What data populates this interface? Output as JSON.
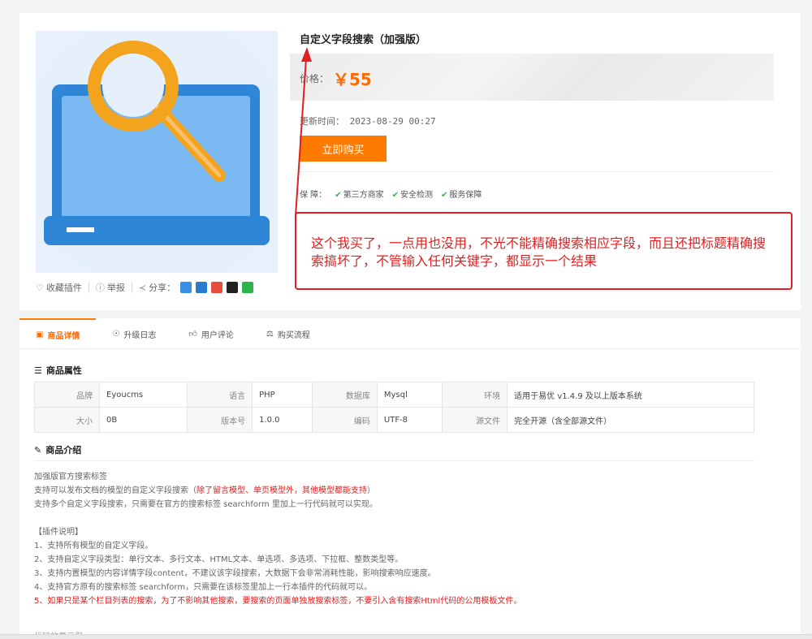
{
  "product": {
    "title": "自定义字段搜索（加强版）",
    "price_label": "价格：",
    "price": "￥55",
    "update_label": "更新时间：",
    "update_time": "2023-08-29 00:27",
    "buy_label": "立即购买",
    "guarantee_label": "保  障：",
    "guarantees": [
      "第三方商家",
      "安全检测",
      "服务保障"
    ]
  },
  "actions": {
    "favorite": "收藏插件",
    "report": "举报",
    "share": "分享："
  },
  "annotation": {
    "text": "这个我买了，一点用也没用，不光不能精确搜索相应字段，而且还把标题精确搜索搞坏了，不管输入任何关键字，都显示一个结果",
    "color": "#e02020"
  },
  "tabs": [
    {
      "label": "商品详情"
    },
    {
      "label": "升级日志"
    },
    {
      "label": "用户评论"
    },
    {
      "label": "购买流程"
    }
  ],
  "attributes": {
    "heading": "商品属性",
    "rows": [
      [
        {
          "k": "品牌",
          "v": "Eyoucms"
        },
        {
          "k": "语言",
          "v": "PHP"
        },
        {
          "k": "数据库",
          "v": "Mysql"
        },
        {
          "k": "环境",
          "v": "适用于易优 v1.4.9 及以上版本系统"
        }
      ],
      [
        {
          "k": "大小",
          "v": "0B"
        },
        {
          "k": "版本号",
          "v": "1.0.0"
        },
        {
          "k": "编码",
          "v": "UTF-8"
        },
        {
          "k": "源文件",
          "v": "完全开源（含全部源文件）"
        }
      ]
    ]
  },
  "intro": {
    "heading": "商品介绍",
    "line1": "加强版官方搜索标签",
    "line2_pre": "支持可以发布文档的模型的自定义字段搜索（",
    "line2_red": "除了留言模型、单页模型外，其他模型都能支持",
    "line2_post": "）",
    "line3": "支持多个自定义字段搜索，只需要在官方的搜索标签 searchform 里加上一行代码就可以实现。",
    "notes_title": "【插件说明】",
    "notes": [
      "1、支持所有模型的自定义字段。",
      "2、支持自定义字段类型：单行文本、多行文本、HTML文本、单选项、多选项、下拉框、整数类型等。",
      "3、支持内置模型的内容详情字段content，不建议该字段搜索，大数据下会非常消耗性能，影响搜索响应速度。",
      "4、支持官方原有的搜索标签 searchform，只需要在该标签里加上一行本插件的代码就可以。"
    ],
    "note_red": "5、如果只是某个栏目列表的搜索，为了不影响其他搜索，要搜索的页面单独放搜索标签，不要引入含有搜索Html代码的公用模板文件。",
    "cut_text": "代码效果示例"
  },
  "colors": {
    "accent": "#ff7a00",
    "price": "#ff6a00",
    "check": "#3bb34a"
  }
}
